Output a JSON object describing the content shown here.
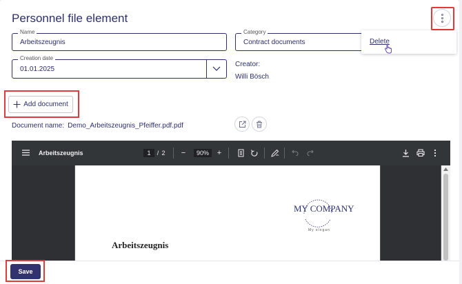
{
  "header": {
    "title": "Personnel file element"
  },
  "form": {
    "name": {
      "label": "Name",
      "value": "Arbeitszeugnis"
    },
    "category": {
      "label": "Category",
      "value": "Contract documents"
    },
    "creation_date": {
      "label": "Creation date",
      "value": "01.01.2025"
    },
    "creator": {
      "label": "Creator:",
      "value": "Willi Bösch"
    }
  },
  "menu": {
    "delete_label": "Delete"
  },
  "actions": {
    "add_document_label": "Add document",
    "save_label": "Save"
  },
  "document": {
    "name_label": "Document name:",
    "file_name": "Demo_Arbeitszeugnis_Pfeiffer.pdf.pdf"
  },
  "pdf_viewer": {
    "title": "Arbeitszeugnis",
    "current_page": "1",
    "page_separator": "/",
    "total_pages": "2",
    "zoom": "90%",
    "zoom_out": "−",
    "zoom_in": "+",
    "page_content": {
      "logo_text": "MY COMPANY",
      "slogan": "My slogan",
      "heading": "Arbeitszeugnis"
    }
  },
  "colors": {
    "primary": "#2b2f6b",
    "highlight": "#e03a3a",
    "save_bg": "#32326e"
  }
}
